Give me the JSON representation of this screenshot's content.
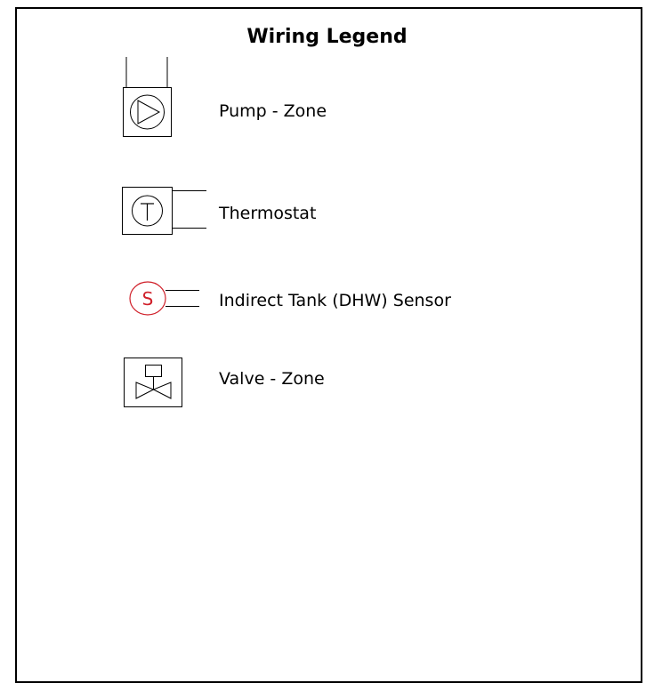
{
  "legend": {
    "title": "Wiring Legend",
    "items": [
      {
        "icon": "pump-icon",
        "label": "Pump - Zone"
      },
      {
        "icon": "thermostat-icon",
        "label": "Thermostat"
      },
      {
        "icon": "sensor-icon",
        "label": "Indirect Tank (DHW) Sensor",
        "symbol_letter": "S",
        "symbol_color": "#d0202a"
      },
      {
        "icon": "valve-icon",
        "label": "Valve - Zone"
      }
    ]
  },
  "colors": {
    "line": "#000000",
    "frame": "#000000",
    "sensor_accent": "#d0202a",
    "background": "#ffffff"
  }
}
